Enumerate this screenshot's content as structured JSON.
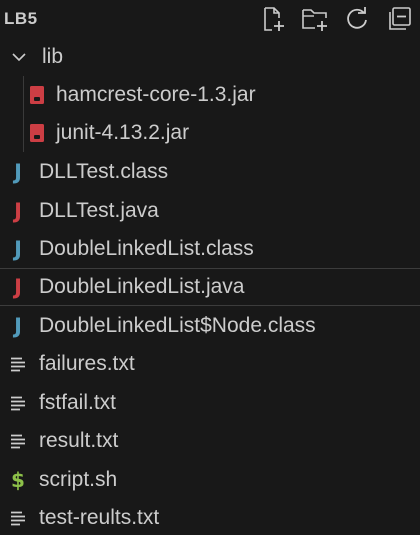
{
  "explorer": {
    "title": "LB5",
    "actions": [
      {
        "name": "new-file",
        "icon": "new-file-icon"
      },
      {
        "name": "new-folder",
        "icon": "new-folder-icon"
      },
      {
        "name": "refresh",
        "icon": "refresh-icon"
      },
      {
        "name": "collapse-all",
        "icon": "collapse-all-icon"
      }
    ]
  },
  "colors": {
    "background": "#181818",
    "text": "#cccccc",
    "class_icon": "#519aba",
    "java_icon": "#cc3e44",
    "jar_icon": "#cc3e44",
    "shell_icon": "#8dc149",
    "text_icon": "#cccccc"
  },
  "tree": {
    "folder": {
      "label": "lib",
      "expanded": true
    },
    "lib_items": [
      {
        "label": "hamcrest-core-1.3.jar",
        "icon": "jar-icon"
      },
      {
        "label": "junit-4.13.2.jar",
        "icon": "jar-icon"
      }
    ],
    "files": [
      {
        "label": "DLLTest.class",
        "icon": "java-class-icon"
      },
      {
        "label": "DLLTest.java",
        "icon": "java-file-icon"
      },
      {
        "label": "DoubleLinkedList.class",
        "icon": "java-class-icon"
      },
      {
        "label": "DoubleLinkedList.java",
        "icon": "java-file-icon",
        "active": true
      },
      {
        "label": "DoubleLinkedList$Node.class",
        "icon": "java-class-icon"
      },
      {
        "label": "failures.txt",
        "icon": "text-file-icon"
      },
      {
        "label": "fstfail.txt",
        "icon": "text-file-icon"
      },
      {
        "label": "result.txt",
        "icon": "text-file-icon"
      },
      {
        "label": "script.sh",
        "icon": "shell-script-icon"
      },
      {
        "label": "test-reults.txt",
        "icon": "text-file-icon"
      }
    ]
  }
}
